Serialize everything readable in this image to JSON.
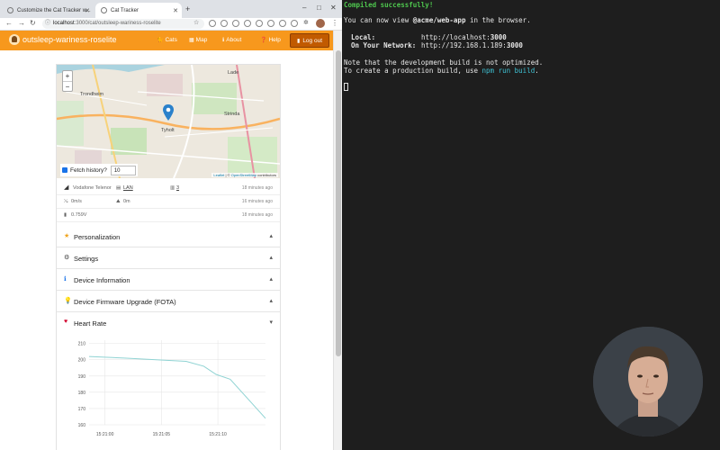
{
  "browser": {
    "tabs": [
      {
        "label": "Customize the Cat Tracker w..."
      },
      {
        "label": "Cat Tracker"
      }
    ],
    "url_host": "localhost",
    "url_rest": ":3000/cat/outsleep-wariness-roselite"
  },
  "app": {
    "brand": "outsleep-wariness-roselite",
    "nav": {
      "cats": "Cats",
      "map": "Map",
      "about": "About",
      "help": "Help",
      "logout": "Log out"
    },
    "map": {
      "zoom_in": "+",
      "zoom_out": "−",
      "labels": {
        "trondheim": "Trondheim",
        "tyholt": "Tyholt",
        "strinda": "Strinda",
        "lade": "Lade"
      },
      "attribution_leaflet": "Leaflet",
      "attribution_sep": " | © ",
      "attribution_osm": "OpenStreetMap",
      "attribution_tail": " contributors"
    },
    "fetch_history": {
      "label": "Fetch history?",
      "value": "10"
    },
    "device_rows": [
      {
        "operator": "Vodafone Telenor",
        "mode": "LAN",
        "band": "3",
        "ago": "18 minutes ago"
      },
      {
        "speed": "0m/s",
        "altitude": "0m",
        "ago": "16 minutes ago"
      },
      {
        "battery": "0.759V",
        "ago": "18 minutes ago"
      }
    ],
    "sections": [
      {
        "title": "Personalization",
        "icon": "star",
        "chevron": "▴"
      },
      {
        "title": "Settings",
        "icon": "gear",
        "chevron": "▴"
      },
      {
        "title": "Device Information",
        "icon": "info",
        "chevron": "▴"
      },
      {
        "title": "Device Firmware Upgrade (FOTA)",
        "icon": "bulb",
        "chevron": "▴"
      },
      {
        "title": "Heart Rate",
        "icon": "heart",
        "chevron": "▾"
      }
    ]
  },
  "chart_data": {
    "type": "line",
    "title": "",
    "xlabel": "",
    "ylabel": "",
    "x_ticks": [
      "15:21:00",
      "15:21:05",
      "15:21:10"
    ],
    "y_ticks": [
      210,
      200,
      190,
      180,
      170,
      160
    ],
    "ylim": [
      160,
      212
    ],
    "series": [
      {
        "name": "",
        "points": [
          {
            "x": 0,
            "y": 202
          },
          {
            "x": 0.2,
            "y": 201
          },
          {
            "x": 0.55,
            "y": 199
          },
          {
            "x": 0.65,
            "y": 196
          },
          {
            "x": 0.72,
            "y": 191
          },
          {
            "x": 0.8,
            "y": 188
          },
          {
            "x": 1.0,
            "y": 164
          }
        ],
        "color": "#8fd3d3"
      }
    ],
    "grid": true
  },
  "terminal": {
    "compiled": "Compiled successfully!",
    "line_view_pre": "You can now view ",
    "line_view_app": "@acme/web-app",
    "line_view_post": " in the browser.",
    "local_label": "Local:",
    "local_url_pre": "http://localhost:",
    "local_url_port": "3000",
    "network_label": "On Your Network:",
    "network_url_pre": "http://192.168.1.189:",
    "network_url_port": "3000",
    "note1": "Note that the development build is not optimized.",
    "note2_pre": "To create a production build, use ",
    "note2_cmd": "npm run build",
    "note2_post": "."
  },
  "colors": {
    "navbar": "#f7981d",
    "logout": "#c15a00",
    "terminal_bg": "#1e1e1e",
    "terminal_green": "#4ec64e",
    "chart_line": "#8fd3d3"
  }
}
